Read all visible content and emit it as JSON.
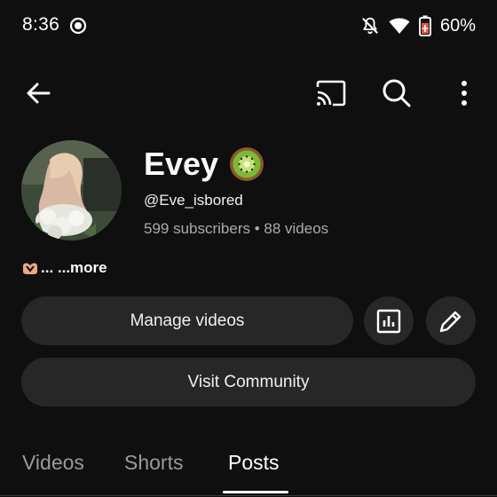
{
  "status_bar": {
    "time": "8:36",
    "battery": "60%",
    "icons": [
      "screen-record-icon",
      "do-not-disturb-bell-icon",
      "wifi-icon",
      "battery-saver-icon"
    ]
  },
  "top_bar": {
    "icons": [
      "back-arrow-icon",
      "cast-icon",
      "search-icon",
      "more-vert-icon"
    ]
  },
  "channel": {
    "name": "Evey",
    "name_emoji": "kiwi-emoji",
    "handle": "@Eve_isbored",
    "stats": "599 subscribers • 88 videos",
    "description": "... ...more"
  },
  "actions": {
    "manage_label": "Manage videos",
    "community_label": "Visit Community",
    "analytics_icon": "analytics-icon",
    "edit_icon": "pencil-icon"
  },
  "tabs": [
    {
      "label": "Videos",
      "selected": false
    },
    {
      "label": "Shorts",
      "selected": false
    },
    {
      "label": "Posts",
      "selected": true
    }
  ],
  "colors": {
    "background": "#0f0f0f",
    "pill": "#272727",
    "secondary_text": "#aaaaaa",
    "battery_accent": "#e5533d"
  }
}
